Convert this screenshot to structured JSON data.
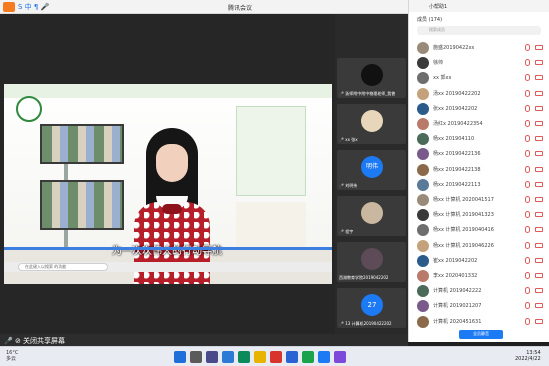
{
  "titlebar": {
    "title": "腾讯会议",
    "ime": "S 中 ¶ 🎤"
  },
  "stage": {
    "subtitle": "为一次次伟大的行动导航",
    "search_placeholder": "在此键入以搜索 的功能"
  },
  "thumbnails": [
    {
      "label": "🎤 浙师附中附中物理老师_我曾",
      "color": "#3a3a3a"
    },
    {
      "label": "🎤 xx 张x",
      "color": "#3a3a3a"
    },
    {
      "label": "🎤 刘明伟",
      "avatar_text": "明伟",
      "color": "#1d7af5"
    },
    {
      "label": "🎤 程宇",
      "color": "#3a3a3a"
    },
    {
      "label": "西湖教育学院2019042202",
      "color": "#3a3a3a"
    },
    {
      "label": "🎤 13 计算机20190422202",
      "avatar_text": "27",
      "color": "#1d7af5"
    }
  ],
  "panel": {
    "host_label": "小帮助1",
    "title": "成员 (174)",
    "search_placeholder": "搜索成员",
    "participants": [
      "施盛20190422xx",
      "徐帅",
      "xx 郭xx",
      "汤xx 20190422202",
      "张xx 2019042202",
      "汤红x 20190422354",
      "杨xx 201904110",
      "杨xx 20190422136",
      "杨xx 20190422138",
      "杨xx 20190422113",
      "杨xx 计算机 2020041517",
      "杨xx 计算机 2019041323",
      "杨xx 计算机 2019040416",
      "杨xx 计算机 2019046226",
      "崔xx 2019042202",
      "李xx 2020401332",
      "计算机 2019042222",
      "计算机 2019021207",
      "计算机 2020451631"
    ],
    "button_label": "全员静音"
  },
  "strip": {
    "share_text": "🎤 ⊘ 关闭共享屏幕"
  },
  "win_taskbar": {
    "weather_temp": "16°C",
    "weather_desc": "多云",
    "time": "13:54",
    "date": "2022/4/22"
  }
}
